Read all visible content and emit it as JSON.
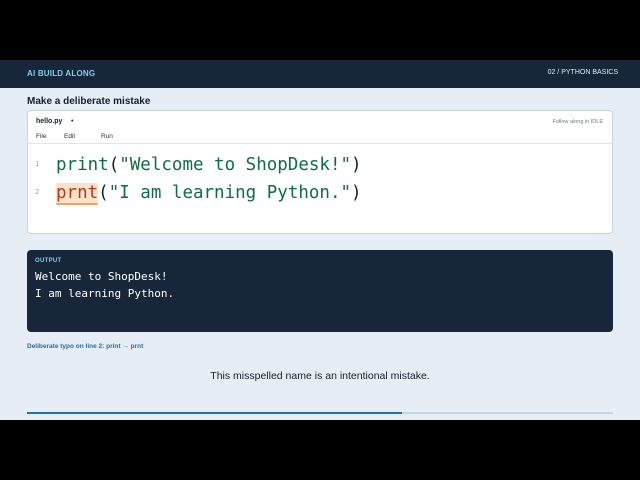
{
  "header": {
    "brand": "AI BUILD ALONG",
    "breadcrumb": "02  /  PYTHON BASICS"
  },
  "heading": "Make a deliberate mistake",
  "editor": {
    "filename": "hello.py",
    "dirty_marker": "•",
    "follow_hint": "Follow along in IDLE",
    "menu": [
      "File",
      "Edit",
      "Run"
    ],
    "lines": [
      {
        "number": "1",
        "func": "print",
        "open": "(",
        "string": "\"Welcome to ShopDesk!\"",
        "close": ")"
      },
      {
        "number": "2",
        "func": "prnt",
        "open": "(",
        "string": "\"I am learning Python.\"",
        "close": ")"
      }
    ]
  },
  "output": {
    "label": "OUTPUT",
    "lines": [
      "Welcome to ShopDesk!",
      "I am learning Python."
    ]
  },
  "note": "Deliberate typo on line 2: print → prnt",
  "caption": "This misspelled name is an intentional mistake.",
  "progress": {
    "fraction": 0.64
  },
  "colors": {
    "accent": "#1f6db3",
    "dark_panel": "#172638",
    "typo_highlight": "#fde2c9",
    "code_green": "#0d6d49"
  }
}
